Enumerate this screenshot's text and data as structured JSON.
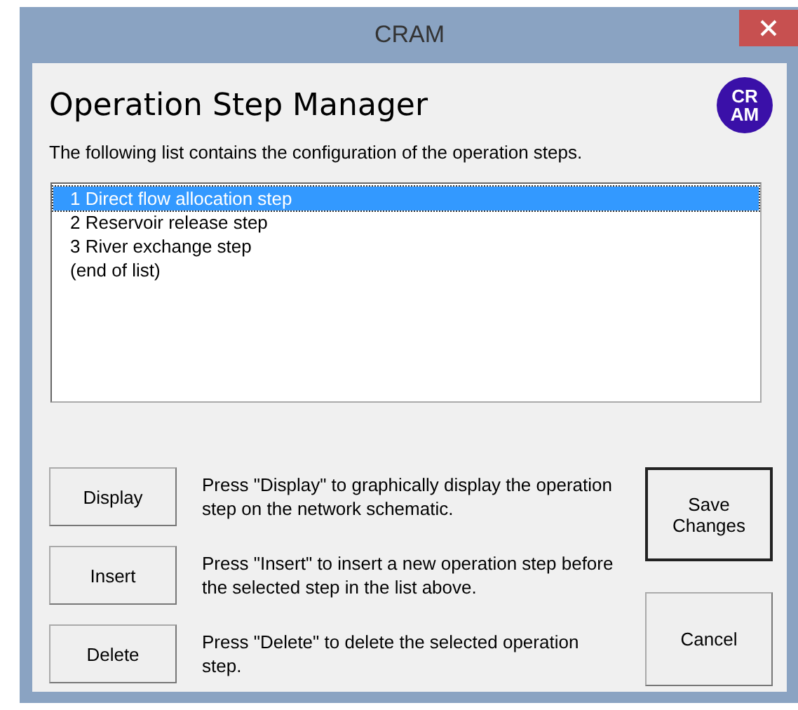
{
  "window": {
    "title": "CRAM"
  },
  "heading": "Operation Step Manager",
  "logo": {
    "lines": [
      "CR",
      "AM"
    ]
  },
  "description": "The following list contains the configuration of the operation steps.",
  "list": {
    "items": [
      {
        "number": "1",
        "label": "Direct flow allocation step",
        "selected": true
      },
      {
        "number": "2",
        "label": "Reservoir release step",
        "selected": false
      },
      {
        "number": "3",
        "label": "River exchange step",
        "selected": false
      },
      {
        "label": "(end of list)",
        "selected": false
      }
    ]
  },
  "actions": [
    {
      "button": "Display",
      "help": "Press \"Display\" to graphically display the operation step on the network schematic."
    },
    {
      "button": "Insert",
      "help": "Press \"Insert\" to insert a new operation step before the selected step in the list above."
    },
    {
      "button": "Delete",
      "help": "Press \"Delete\" to delete the selected operation step."
    }
  ],
  "buttons": [
    {
      "label": "Save Changes",
      "default": true
    },
    {
      "label": "Cancel",
      "default": false
    }
  ]
}
